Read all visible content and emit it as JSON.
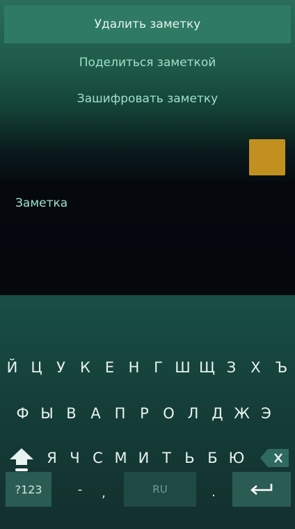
{
  "menu": {
    "delete": "Удалить заметку",
    "share": "Поделиться заметкой",
    "encrypt": "Зашифровать заметку"
  },
  "note": {
    "placeholder": "Заметка",
    "color": "#c2901f"
  },
  "keyboard": {
    "row1": [
      "Й",
      "Ц",
      "У",
      "К",
      "Е",
      "Н",
      "Г",
      "Ш",
      "Щ",
      "З",
      "Х",
      "Ъ"
    ],
    "row2": [
      "Ф",
      "Ы",
      "В",
      "А",
      "П",
      "Р",
      "О",
      "Л",
      "Д",
      "Ж",
      "Э"
    ],
    "row3": [
      "Я",
      "Ч",
      "С",
      "М",
      "И",
      "Т",
      "Ь",
      "Б",
      "Ю"
    ],
    "symbols": "?123",
    "dash": "-",
    "comma": ",",
    "space_label": "RU",
    "period": ".",
    "icons": {
      "shift": "shift-icon",
      "backspace": "backspace-icon",
      "enter": "enter-icon"
    }
  }
}
